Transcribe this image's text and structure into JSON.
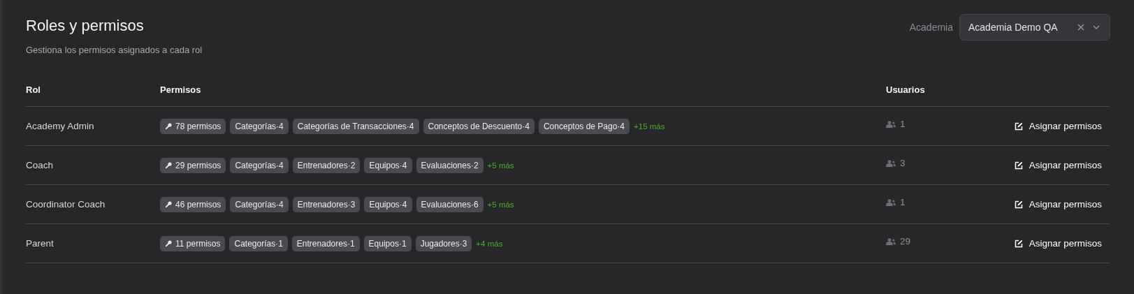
{
  "header": {
    "title": "Roles y permisos",
    "subtitle": "Gestiona los permisos asignados a cada rol"
  },
  "academy_filter": {
    "label": "Academia",
    "value": "Academia Demo QA"
  },
  "table": {
    "columns": [
      "Rol",
      "Permisos",
      "Usuarios"
    ],
    "rows": [
      {
        "role": "Academy Admin",
        "total": "78 permisos",
        "tags": [
          "Categorías·4",
          "Categorías de Transacciones·4",
          "Conceptos de Descuento·4",
          "Conceptos de Pago·4"
        ],
        "more": "+15 más",
        "users": "1",
        "action": "Asignar permisos"
      },
      {
        "role": "Coach",
        "total": "29 permisos",
        "tags": [
          "Categorías·4",
          "Entrenadores·2",
          "Equipos·4",
          "Evaluaciones·2"
        ],
        "more": "+5 más",
        "users": "3",
        "action": "Asignar permisos"
      },
      {
        "role": "Coordinator Coach",
        "total": "46 permisos",
        "tags": [
          "Categorías·4",
          "Entrenadores·3",
          "Equipos·4",
          "Evaluaciones·6"
        ],
        "more": "+5 más",
        "users": "1",
        "action": "Asignar permisos"
      },
      {
        "role": "Parent",
        "total": "11 permisos",
        "tags": [
          "Categorías·1",
          "Entrenadores·1",
          "Equipos·1",
          "Jugadores·3"
        ],
        "more": "+4 más",
        "users": "29",
        "action": "Asignar permisos"
      }
    ]
  }
}
